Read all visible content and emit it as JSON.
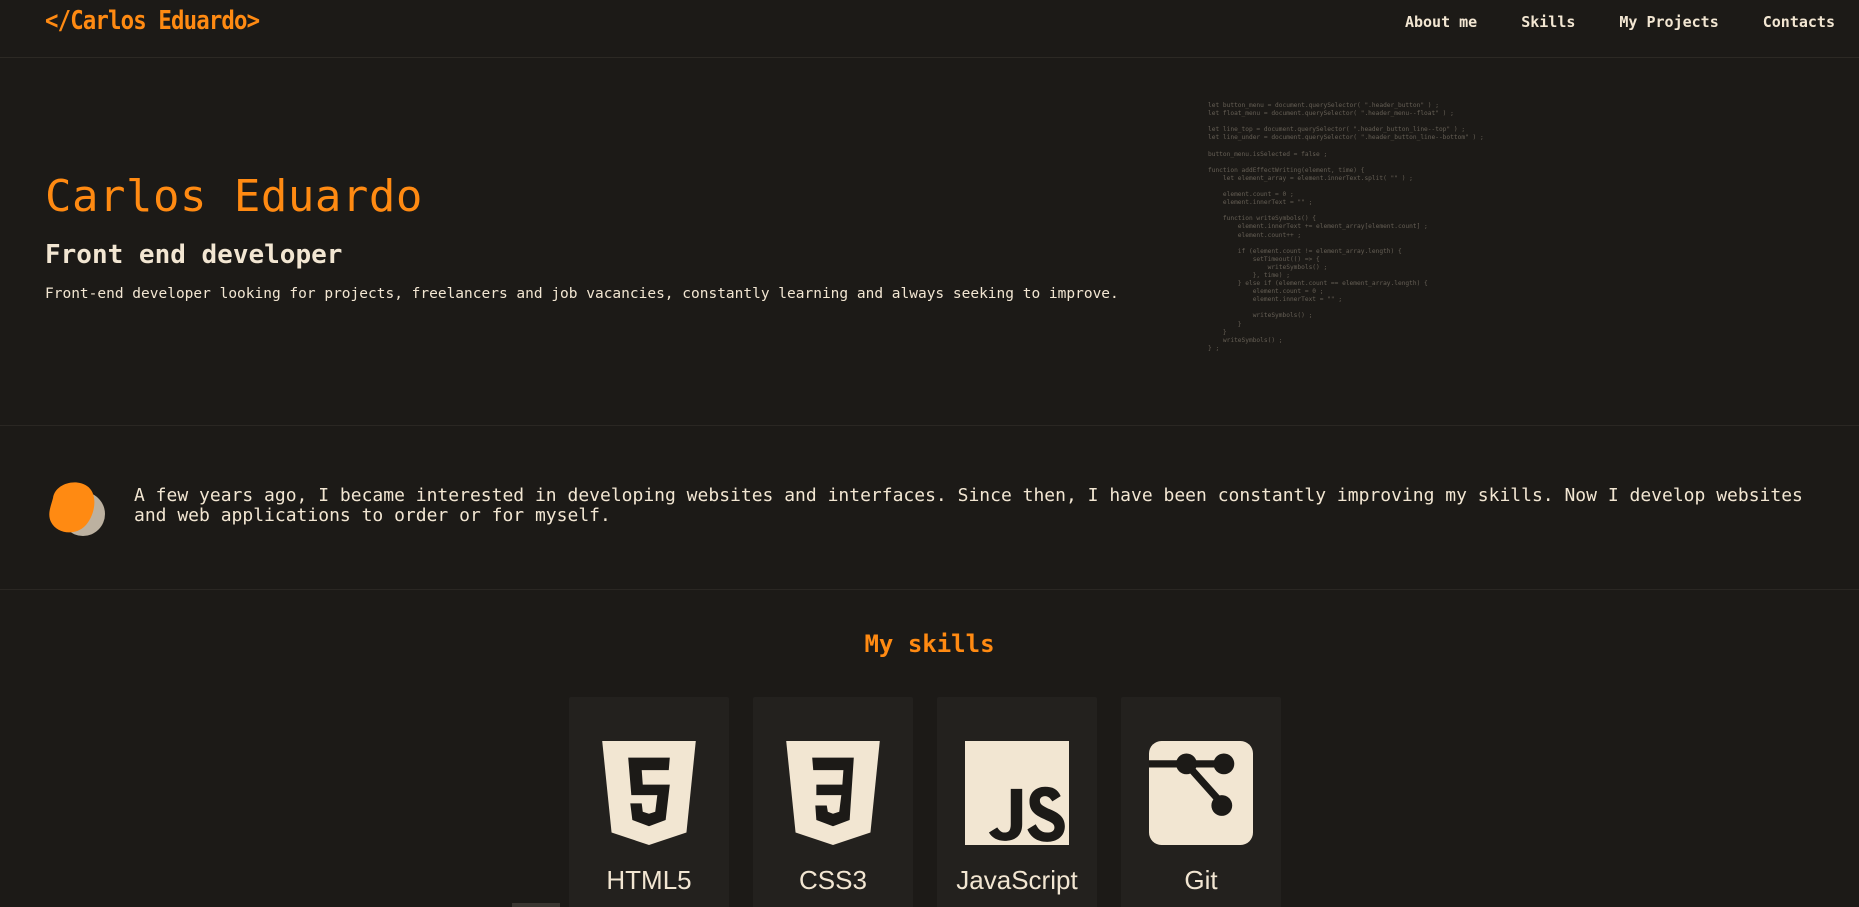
{
  "header": {
    "logo": "</Carlos Eduardo>",
    "nav": [
      "About me",
      "Skills",
      "My Projects",
      "Contacts"
    ]
  },
  "hero": {
    "name": "Carlos Eduardo",
    "title": "Front end developer",
    "description": "Front-end developer looking for projects, freelancers and job vacancies, constantly learning and always seeking to improve."
  },
  "code_snippet": [
    "let button_menu = document.querySelector( \".header_button\" ) ;",
    "let float_menu = document.querySelector( \".header_menu--float\" ) ;",
    "",
    "let line_top = document.querySelector( \".header_button_line--top\" ) ;",
    "let line_under = document.querySelector( \".header_button_line--bottom\" ) ;",
    "",
    "button_menu.isSelected = false ;",
    "",
    "function addEffectWriting(element, time) {",
    "    let element_array = element.innerText.split( \"\" ) ;",
    "",
    "    element.count = 0 ;",
    "    element.innerText = \"\" ;",
    "",
    "    function writeSymbols() {",
    "        element.innerText += element_array[element.count] ;",
    "        element.count++ ;",
    "",
    "        if (element.count != element_array.length) {",
    "            setTimeout(() => {",
    "                writeSymbols() ;",
    "            }, time) ;",
    "        } else if (element.count == element_array.length) {",
    "            element.count = 0 ;",
    "            element.innerText = \"\" ;",
    "",
    "            writeSymbols() ;",
    "        }",
    "    }",
    "    writeSymbols() ;",
    "} ;"
  ],
  "about": {
    "text": "A few years ago, I became interested in developing websites and interfaces. Since then, I have been constantly improving my skills. Now I develop websites and web applications to order or for myself."
  },
  "skills": {
    "title": "My skills",
    "items": [
      {
        "label": "HTML5",
        "icon": "html5-icon"
      },
      {
        "label": "CSS3",
        "icon": "css3-icon"
      },
      {
        "label": "JavaScript",
        "icon": "javascript-icon"
      },
      {
        "label": "Git",
        "icon": "git-icon"
      }
    ]
  },
  "colors": {
    "background": "#1c1a17",
    "accent": "#ff8a12",
    "text": "#f2e6d2",
    "card": "#23211e"
  }
}
